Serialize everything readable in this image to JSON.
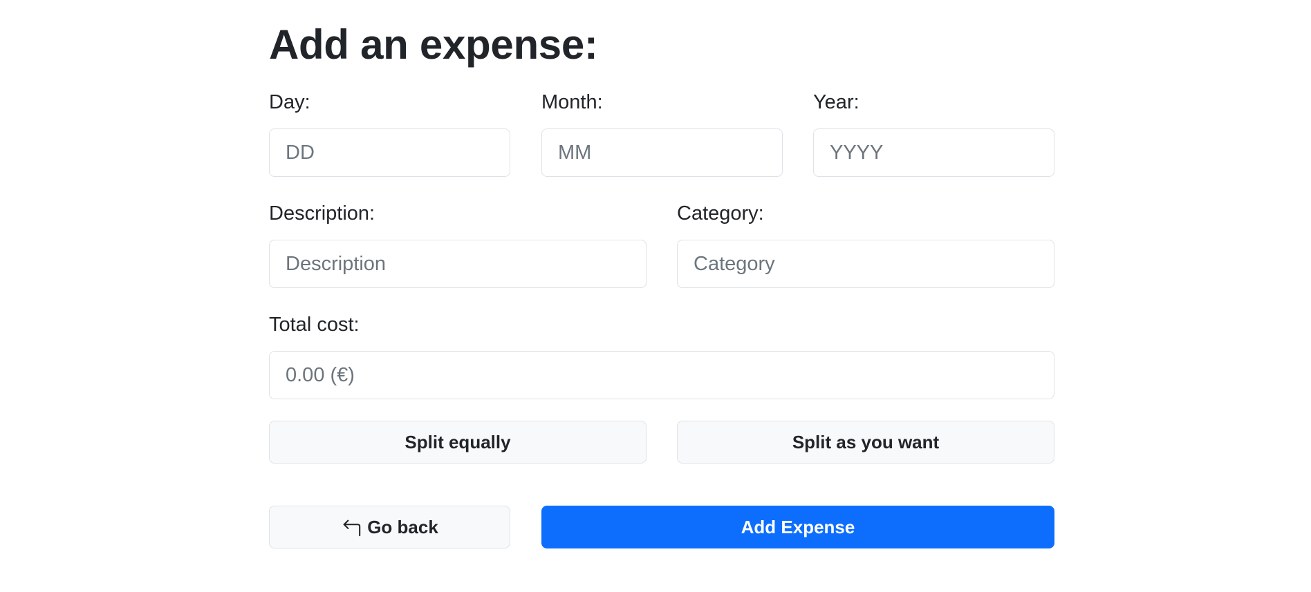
{
  "form": {
    "title": "Add an expense:",
    "day": {
      "label": "Day:",
      "placeholder": "DD",
      "value": ""
    },
    "month": {
      "label": "Month:",
      "placeholder": "MM",
      "value": ""
    },
    "year": {
      "label": "Year:",
      "placeholder": "YYYY",
      "value": ""
    },
    "description": {
      "label": "Description:",
      "placeholder": "Description",
      "value": ""
    },
    "category": {
      "label": "Category:",
      "placeholder": "Category",
      "value": ""
    },
    "total_cost": {
      "label": "Total cost:",
      "placeholder": "0.00 (€)",
      "value": ""
    }
  },
  "split": {
    "equally_label": "Split equally",
    "custom_label": "Split as you want"
  },
  "actions": {
    "back_label": "Go back",
    "back_icon": "arrow-return-left-icon",
    "submit_label": "Add Expense",
    "primary_color": "#0d6efd"
  }
}
